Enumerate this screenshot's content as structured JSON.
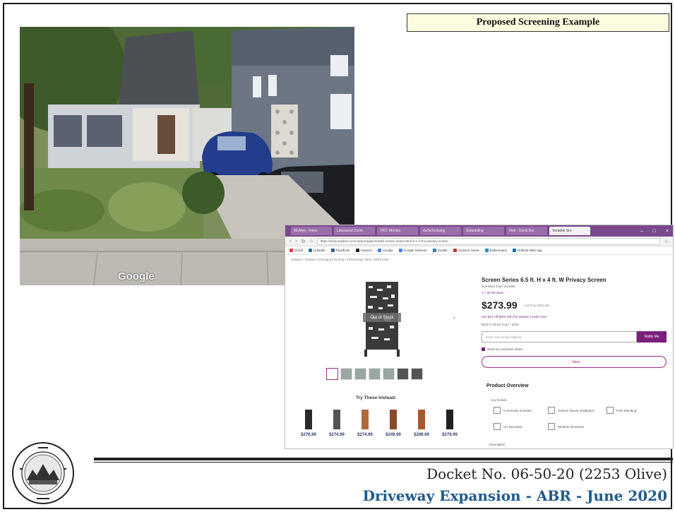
{
  "slide": {
    "title": "Proposed Screening Example",
    "docket": "Docket No. 06-50-20 (2253 Olive)",
    "subtitle": "Driveway Expansion - ABR - June 2020"
  },
  "photo": {
    "watermark": "Google"
  },
  "browser": {
    "tabs": [
      "McAfee - Inbox",
      "Lakewood Zoom",
      "TRC: Monitor",
      "ds/Scheduling",
      "Scheduling",
      "Mail - David Bar",
      "Veradek Scr"
    ],
    "url": "https://www.wayfair.com/outdoor/pdp/veradek-screen-series-65-ft-h-x-4-ft-w-privacy-screen",
    "bookmarks": [
      "Gmail",
      "LinkedIn",
      "Facebook",
      "Amazon",
      "Google",
      "Google Adsense",
      "Doodle",
      "Amazon Home",
      "ExtDomains",
      "Outlook Web App"
    ],
    "breadcrumb": "Outdoor / Outdoor Fencing & Flooring / All Fencing / SKU: VDKX1644",
    "out_of_stock": "Out of Stock",
    "try_label": "Try These Instead:",
    "try_prices": [
      "$276.99",
      "$274.99",
      "$274.99",
      "$249.99",
      "$289.99",
      "$279.99"
    ],
    "product": {
      "title": "Screen Series 6.5 ft. H x 4 ft. W Privacy Screen",
      "see_more": "See More from Veradek",
      "rating": "4.7  96 Reviews",
      "price": "$273.99",
      "was_price": "List Price $311.99",
      "promo": "Get $40 Off $250 with the Wayfair Credit Card",
      "ships": "Back in Stock Aug 7, 2020",
      "email_placeholder": "Enter Your Email Address",
      "submit": "Notify Me",
      "send_me": "Send me exclusive deals",
      "save": "♡ Save",
      "overview": "Product Overview",
      "key_details": "Key Details",
      "features": [
        "Commonly Included",
        "Surface Mount Installation",
        "Free Standing",
        "UV Resistant",
        "Weather Resistant"
      ],
      "description": "Description"
    }
  },
  "colors": {
    "title_box_bg": "#fffde0",
    "subtitle_blue": "#1f5a8c",
    "wayfair_purple": "#7b1f7a"
  }
}
